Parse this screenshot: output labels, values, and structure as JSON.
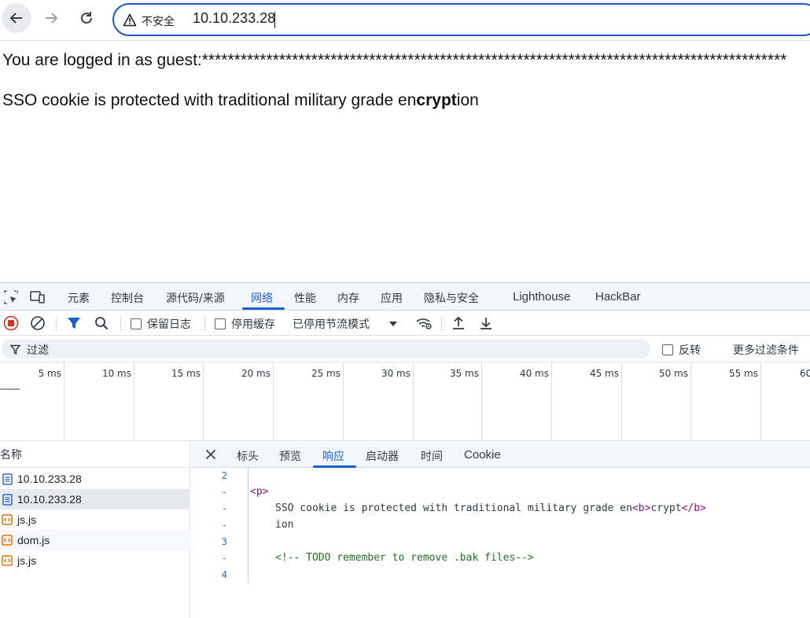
{
  "browser": {
    "security_label": "不安全",
    "url": "10.10.233.28"
  },
  "page": {
    "login_text": "You are logged in as guest:*******************************************************************************************",
    "sso_prefix": "SSO cookie is protected with traditional military grade en",
    "sso_bold": "crypt",
    "sso_suffix": "ion"
  },
  "devtools": {
    "tabs": [
      "元素",
      "控制台",
      "源代码/来源",
      "网络",
      "性能",
      "内存",
      "应用",
      "隐私与安全",
      "Lighthouse",
      "HackBar"
    ],
    "active_tab": "网络",
    "network_toolbar": {
      "preserve_log": "保留日志",
      "disable_cache": "停用缓存",
      "throttling": "已停用节流模式"
    },
    "filter": {
      "placeholder": "过滤",
      "invert": "反转",
      "more_filters": "更多过滤条件"
    },
    "timeline_labels": [
      "5 ms",
      "10 ms",
      "15 ms",
      "20 ms",
      "25 ms",
      "30 ms",
      "35 ms",
      "40 ms",
      "45 ms",
      "50 ms",
      "55 ms",
      "60"
    ],
    "requests": {
      "header": "名称",
      "rows": [
        {
          "name": "10.10.233.28",
          "type": "document"
        },
        {
          "name": "10.10.233.28",
          "type": "document"
        },
        {
          "name": "js.js",
          "type": "script"
        },
        {
          "name": "dom.js",
          "type": "script"
        },
        {
          "name": "js.js",
          "type": "script"
        }
      ]
    },
    "detail_tabs": [
      "标头",
      "预览",
      "响应",
      "启动器",
      "时间",
      "Cookie"
    ],
    "active_detail_tab": "响应",
    "response": {
      "gutter": [
        "2",
        "-",
        "-",
        "-",
        "3",
        "-",
        "4"
      ],
      "open_tag": "<p>",
      "line_text": "SSO cookie is protected with traditional military grade en",
      "b_open": "<b>",
      "b_text": "crypt",
      "b_close": "</b>",
      "line_text_2": "ion",
      "comment": "<!-- TODO remember to remove .bak files-->"
    }
  },
  "colors": {
    "accent": "#1a5fd1",
    "record_red": "#d93025",
    "filter_blue": "#1a5fd1"
  }
}
